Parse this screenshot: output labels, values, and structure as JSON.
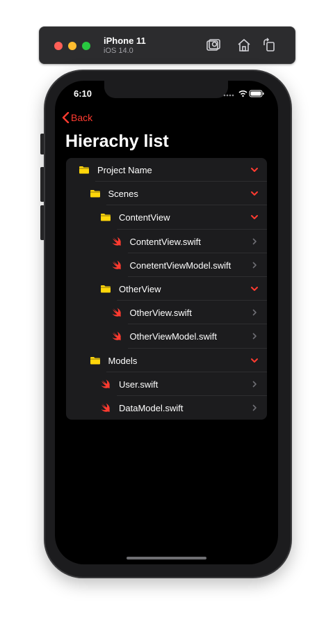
{
  "simulator": {
    "device_name": "iPhone 11",
    "os_version": "iOS 14.0"
  },
  "status_bar": {
    "time": "6:10"
  },
  "nav": {
    "back_label": "Back",
    "title": "Hierachy list"
  },
  "accent_color": "#ff3b30",
  "folder_color": "#ffd60a",
  "rows": [
    {
      "label": "Project Name",
      "kind": "folder",
      "depth": 0,
      "expanded": true
    },
    {
      "label": "Scenes",
      "kind": "folder",
      "depth": 1,
      "expanded": true
    },
    {
      "label": "ContentView",
      "kind": "folder",
      "depth": 2,
      "expanded": true
    },
    {
      "label": "ContentView.swift",
      "kind": "swift-file",
      "depth": 3
    },
    {
      "label": "ConetentViewModel.swift",
      "kind": "swift-file",
      "depth": 3
    },
    {
      "label": "OtherView",
      "kind": "folder",
      "depth": 2,
      "expanded": true
    },
    {
      "label": "OtherView.swift",
      "kind": "swift-file",
      "depth": 3
    },
    {
      "label": "OtherViewModel.swift",
      "kind": "swift-file",
      "depth": 3
    },
    {
      "label": "Models",
      "kind": "folder",
      "depth": 1,
      "expanded": true
    },
    {
      "label": "User.swift",
      "kind": "swift-file",
      "depth": 2
    },
    {
      "label": "DataModel.swift",
      "kind": "swift-file",
      "depth": 2
    }
  ]
}
